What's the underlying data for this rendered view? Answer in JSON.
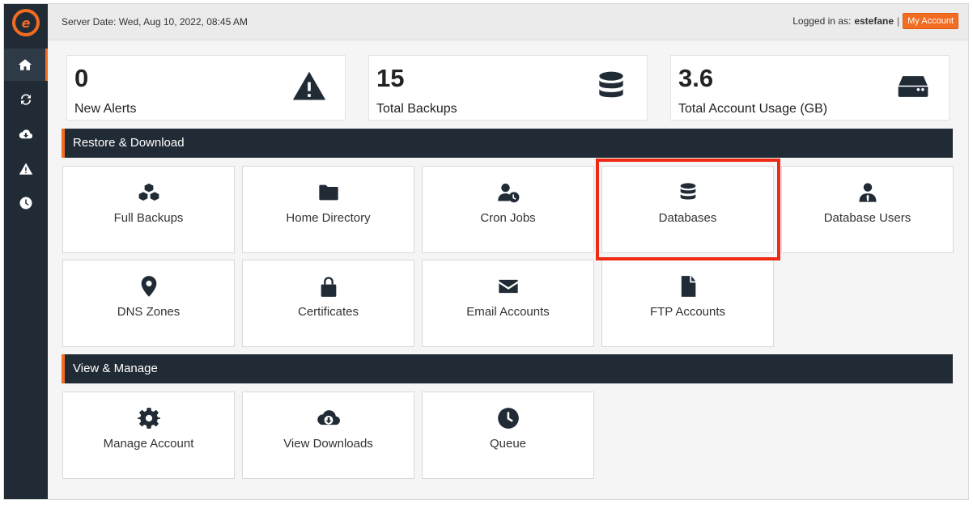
{
  "topbar": {
    "server_date": "Server Date: Wed, Aug 10, 2022, 08:45 AM",
    "logged_in_label": "Logged in as:",
    "username": "estefane",
    "separator": "|",
    "my_account_label": "My Account"
  },
  "sidebar": {
    "logo_letter": "e",
    "items": [
      {
        "icon": "home-icon",
        "active": true
      },
      {
        "icon": "refresh-icon",
        "active": false
      },
      {
        "icon": "cloud-download-icon",
        "active": false
      },
      {
        "icon": "warning-icon",
        "active": false
      },
      {
        "icon": "clock-icon",
        "active": false
      }
    ]
  },
  "stats": [
    {
      "value": "0",
      "label": "New Alerts",
      "icon": "warning-icon"
    },
    {
      "value": "15",
      "label": "Total Backups",
      "icon": "database-icon"
    },
    {
      "value": "3.6",
      "label": "Total Account Usage (GB)",
      "icon": "hard-drive-icon"
    }
  ],
  "sections": {
    "restore": {
      "title": "Restore & Download",
      "tiles": [
        {
          "label": "Full Backups",
          "icon": "cubes-icon"
        },
        {
          "label": "Home Directory",
          "icon": "folder-icon"
        },
        {
          "label": "Cron Jobs",
          "icon": "user-clock-icon"
        },
        {
          "label": "Databases",
          "icon": "database-icon"
        },
        {
          "label": "Database Users",
          "icon": "user-tie-icon"
        },
        {
          "label": "DNS Zones",
          "icon": "map-marker-icon"
        },
        {
          "label": "Certificates",
          "icon": "lock-icon"
        },
        {
          "label": "Email Accounts",
          "icon": "envelope-icon"
        },
        {
          "label": "FTP Accounts",
          "icon": "file-icon"
        }
      ]
    },
    "manage": {
      "title": "View & Manage",
      "tiles": [
        {
          "label": "Manage Account",
          "icon": "cog-icon"
        },
        {
          "label": "View Downloads",
          "icon": "cloud-download-icon"
        },
        {
          "label": "Queue",
          "icon": "clock-icon"
        }
      ]
    }
  },
  "colors": {
    "sidebar": "#212b36",
    "accent": "#f26c22",
    "highlight": "#ee2a15"
  }
}
